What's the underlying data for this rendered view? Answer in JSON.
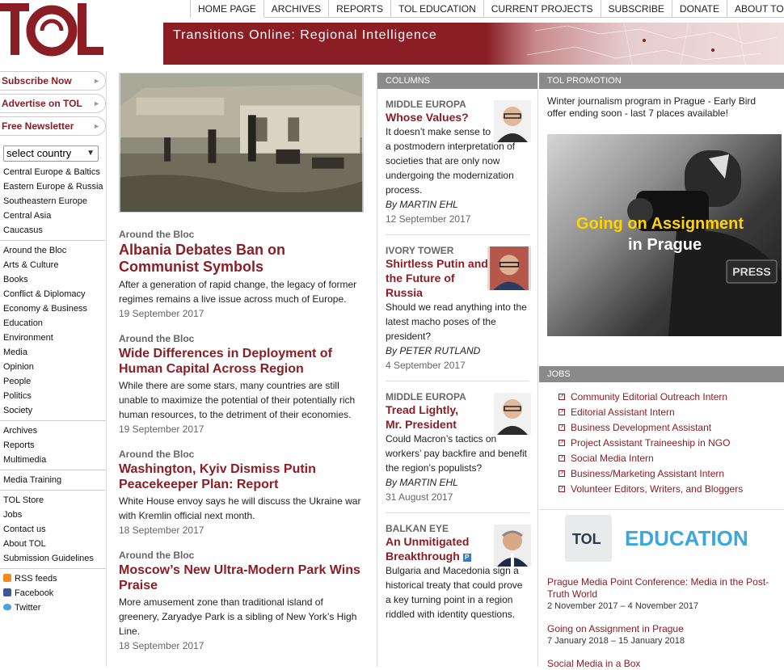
{
  "header": {
    "logo_text": "TOL",
    "tagline": "Transitions Online: Regional Intelligence",
    "nav": [
      "HOME PAGE",
      "ARCHIVES",
      "REPORTS",
      "TOL EDUCATION",
      "CURRENT PROJECTS",
      "SUBSCRIBE",
      "DONATE",
      "ABOUT TOL"
    ]
  },
  "sidebar": {
    "buttons": [
      "Subscribe Now",
      "Advertise on TOL",
      "Free Newsletter"
    ],
    "country_select": "select country",
    "regions": [
      "Central Europe & Baltics",
      "Eastern Europe & Russia",
      "Southeastern Europe",
      "Central Asia",
      "Caucasus"
    ],
    "topics": [
      "Around the Bloc",
      "Arts & Culture",
      "Books",
      "Conflict & Diplomacy",
      "Economy & Business",
      "Education",
      "Environment",
      "Media",
      "Opinion",
      "People",
      "Politics",
      "Society"
    ],
    "sections": [
      "Archives",
      "Reports",
      "Multimedia"
    ],
    "training": [
      "Media Training"
    ],
    "misc": [
      "TOL Store",
      "Jobs",
      "Contact us",
      "About TOL",
      "Submission Guidelines"
    ],
    "social": [
      "RSS feeds",
      "Facebook",
      "Twitter"
    ]
  },
  "main": {
    "articles": [
      {
        "category": "Around the Bloc",
        "title": "Albania Debates Ban on Communist Symbols",
        "summary": "After a generation of rapid change, the legacy of former regimes remains a live issue across much of Europe.",
        "date": "19 September 2017"
      },
      {
        "category": "Around the Bloc",
        "title": "Wide Differences in Deployment of Human Capital Across Region",
        "summary": "While there are some stars, many countries are still unable to maximize the potential of their potentially rich human resources, to the detriment of their economies.",
        "date": "19 September 2017"
      },
      {
        "category": "Around the Bloc",
        "title": "Washington, Kyiv Dismiss Putin Peacekeeper Plan: Report",
        "summary": "White House envoy says he will discuss the Ukraine war with Kremlin official next month.",
        "date": "18 September 2017"
      },
      {
        "category": "Around the Bloc",
        "title": "Moscow’s New Ultra-Modern Park Wins Praise",
        "summary": "More amusement zone than traditional island of greenery, Zaryadye Park is a sibling of New York’s High Line.",
        "date": "18 September 2017"
      }
    ]
  },
  "columns": {
    "header": "COLUMNS",
    "items": [
      {
        "type": "MIDDLE EUROPA",
        "title": "Whose Values?",
        "text": "It doesn’t make sense to apply a postmodern interpretation of societies that are only now undergoing the modernization process.",
        "author": "By MARTIN EHL",
        "date": "12 September 2017"
      },
      {
        "type": "IVORY TOWER",
        "title": "Shirtless Putin and the Future of Russia",
        "text": "Should we read anything into the latest macho poses of the president?",
        "author": "By PETER RUTLAND",
        "date": "4 September 2017"
      },
      {
        "type": "MIDDLE EUROPA",
        "title": "Tread Lightly, Mr. President",
        "text": "Could Macron’s tactics on workers’ pay backfire and benefit the region’s populists?",
        "author": "By MARTIN EHL",
        "date": "31 August 2017"
      },
      {
        "type": "BALKAN EYE",
        "title": "An Unmitigated Breakthrough",
        "text": "Bulgaria and Macedonia sign a historical treaty that could prove a key turning point in a region riddled with identity questions.",
        "author": "",
        "date": ""
      }
    ]
  },
  "promo": {
    "header": "TOL PROMOTION",
    "text": "Winter journalism program in Prague - Early Bird offer ending soon - last 7 places available!",
    "image_line1": "Going on Assignment",
    "image_line2": "in Prague",
    "press_label": "PRESS"
  },
  "jobs": {
    "header": "JOBS",
    "items": [
      "Community Editorial Outreach Intern",
      "Editorial Assistant Intern",
      "Business Development Assistant",
      "Project Assistant Traineeship in NGO",
      "Social Media Intern",
      "Business/Marketing Assistant Intern",
      "Volunteer Editors, Writers, and Bloggers"
    ]
  },
  "education": {
    "logo_text": "TOL",
    "title": "EDUCATION",
    "events": [
      {
        "title": "Prague Media Point Conference: Media in the Post-Truth World",
        "date": "2 November 2017 – 4 November 2017"
      },
      {
        "title": "Going on Assignment in Prague",
        "date": "7 January 2018 – 15 January 2018"
      },
      {
        "title": "Social Media in a Box",
        "date": ""
      }
    ]
  },
  "colors": {
    "brand": "#8a1e24",
    "panel_header": "#8a8a8a",
    "education_blue": "#39a8dc"
  }
}
